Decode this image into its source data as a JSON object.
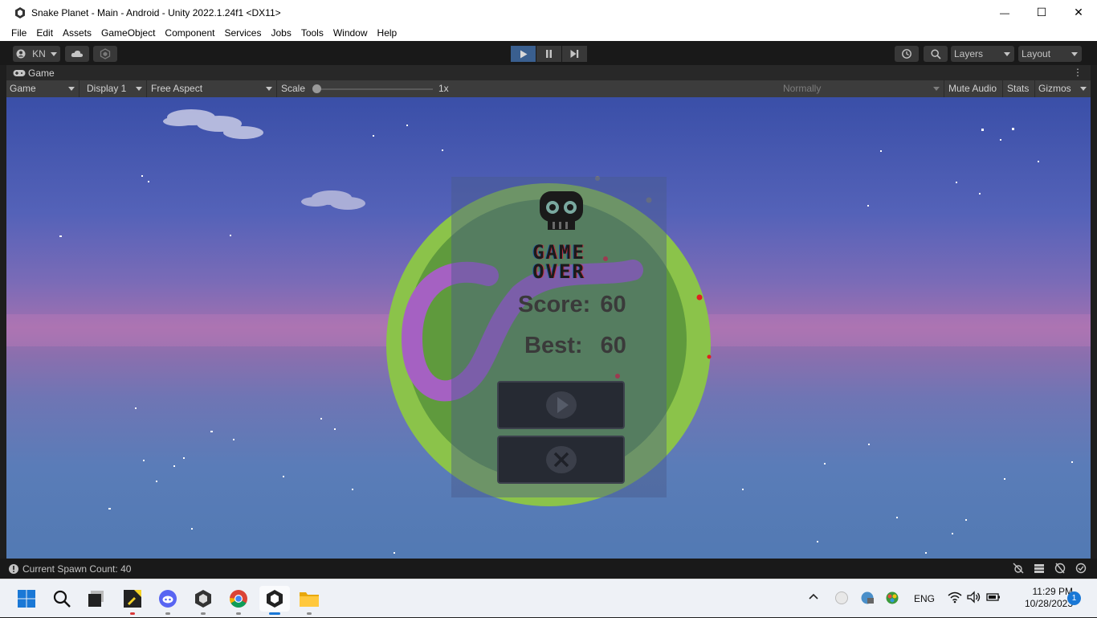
{
  "window": {
    "title": "Snake Planet - Main - Android - Unity 2022.1.24f1 <DX11>",
    "controls": {
      "minimize": "—",
      "maximize": "☐",
      "close": "✕"
    }
  },
  "menu": [
    "File",
    "Edit",
    "Assets",
    "GameObject",
    "Component",
    "Services",
    "Jobs",
    "Tools",
    "Window",
    "Help"
  ],
  "toolbar": {
    "account": "KN",
    "search_icon": "search-icon",
    "layers": "Layers",
    "layout": "Layout",
    "play_active_color": "#3a5f8f"
  },
  "tab": {
    "title": "Game"
  },
  "gamebar": {
    "view": "Game",
    "display": "Display 1",
    "aspect": "Free Aspect",
    "scale_label": "Scale",
    "scale_value": "1x",
    "play_mode": "Normally",
    "mute": "Mute Audio",
    "stats": "Stats",
    "gizmos": "Gizmos"
  },
  "game": {
    "title_line1": "GAME",
    "title_line2": "OVER",
    "score_label": "Score:",
    "score_value": "60",
    "best_label": "Best:",
    "best_value": "60",
    "planet_color": "#8bc34a",
    "snake_color": "#a561c2"
  },
  "status": {
    "message": "Current Spawn Count: 40"
  },
  "taskbar": {
    "apps": [
      "start-icon",
      "search-icon",
      "task-view-icon",
      "sticky-notes-icon",
      "discord-icon",
      "unity-hub-icon",
      "chrome-icon",
      "unity-icon",
      "file-explorer-icon"
    ],
    "language": "ENG",
    "time": "11:29 PM",
    "date": "10/28/2023",
    "notifications": "1"
  }
}
